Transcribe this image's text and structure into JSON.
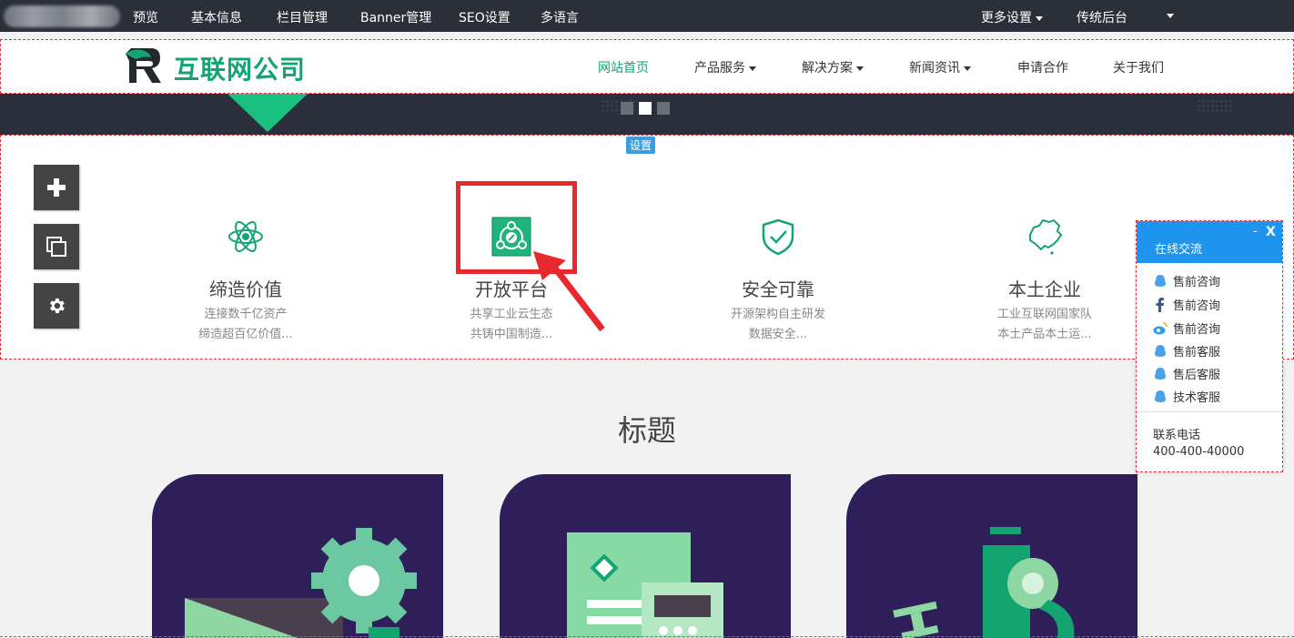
{
  "admin_bar": {
    "items": [
      "预览",
      "基本信息",
      "栏目管理",
      "Banner管理",
      "SEO设置",
      "多语言"
    ],
    "more_settings": "更多设置",
    "legacy_backend": "传统后台"
  },
  "site": {
    "logo_text": "互联网公司",
    "nav": [
      {
        "label": "网站首页",
        "active": true
      },
      {
        "label": "产品服务"
      },
      {
        "label": "解决方案"
      },
      {
        "label": "新闻资讯"
      },
      {
        "label": "申请合作"
      },
      {
        "label": "关于我们"
      }
    ]
  },
  "settings_tag": "设置",
  "features": [
    {
      "title": "缔造价值",
      "desc1": "连接数千亿资产",
      "desc2": "缔造超百亿价值...",
      "icon": "atom-icon"
    },
    {
      "title": "开放平台",
      "desc1": "共享工业云生态",
      "desc2": "共铸中国制造...",
      "icon": "share-edit-icon"
    },
    {
      "title": "安全可靠",
      "desc1": "开源架构自主研发",
      "desc2": "数据安全...",
      "icon": "shield-check-icon"
    },
    {
      "title": "本土企业",
      "desc1": "工业互联网国家队",
      "desc2": "本土产品本土运...",
      "icon": "china-map-icon"
    }
  ],
  "section_title": "标题",
  "chat": {
    "title": "在线交流",
    "minimize": "-",
    "close": "X",
    "items": [
      {
        "label": "售前咨询",
        "icon": "qq-icon"
      },
      {
        "label": "售前咨询",
        "icon": "facebook-icon"
      },
      {
        "label": "售前咨询",
        "icon": "weibo-icon"
      },
      {
        "label": "售前客服",
        "icon": "qq-icon"
      },
      {
        "label": "售后客服",
        "icon": "qq-icon"
      },
      {
        "label": "技术客服",
        "icon": "qq-icon"
      }
    ],
    "contact_label": "联系电话",
    "phone": "400-400-40000"
  },
  "colors": {
    "brand": "#12a571",
    "admin_bar": "#2b2f3a",
    "chat_head": "#1d95ee",
    "card": "#2e1f5b",
    "highlight": "#e8282f"
  }
}
